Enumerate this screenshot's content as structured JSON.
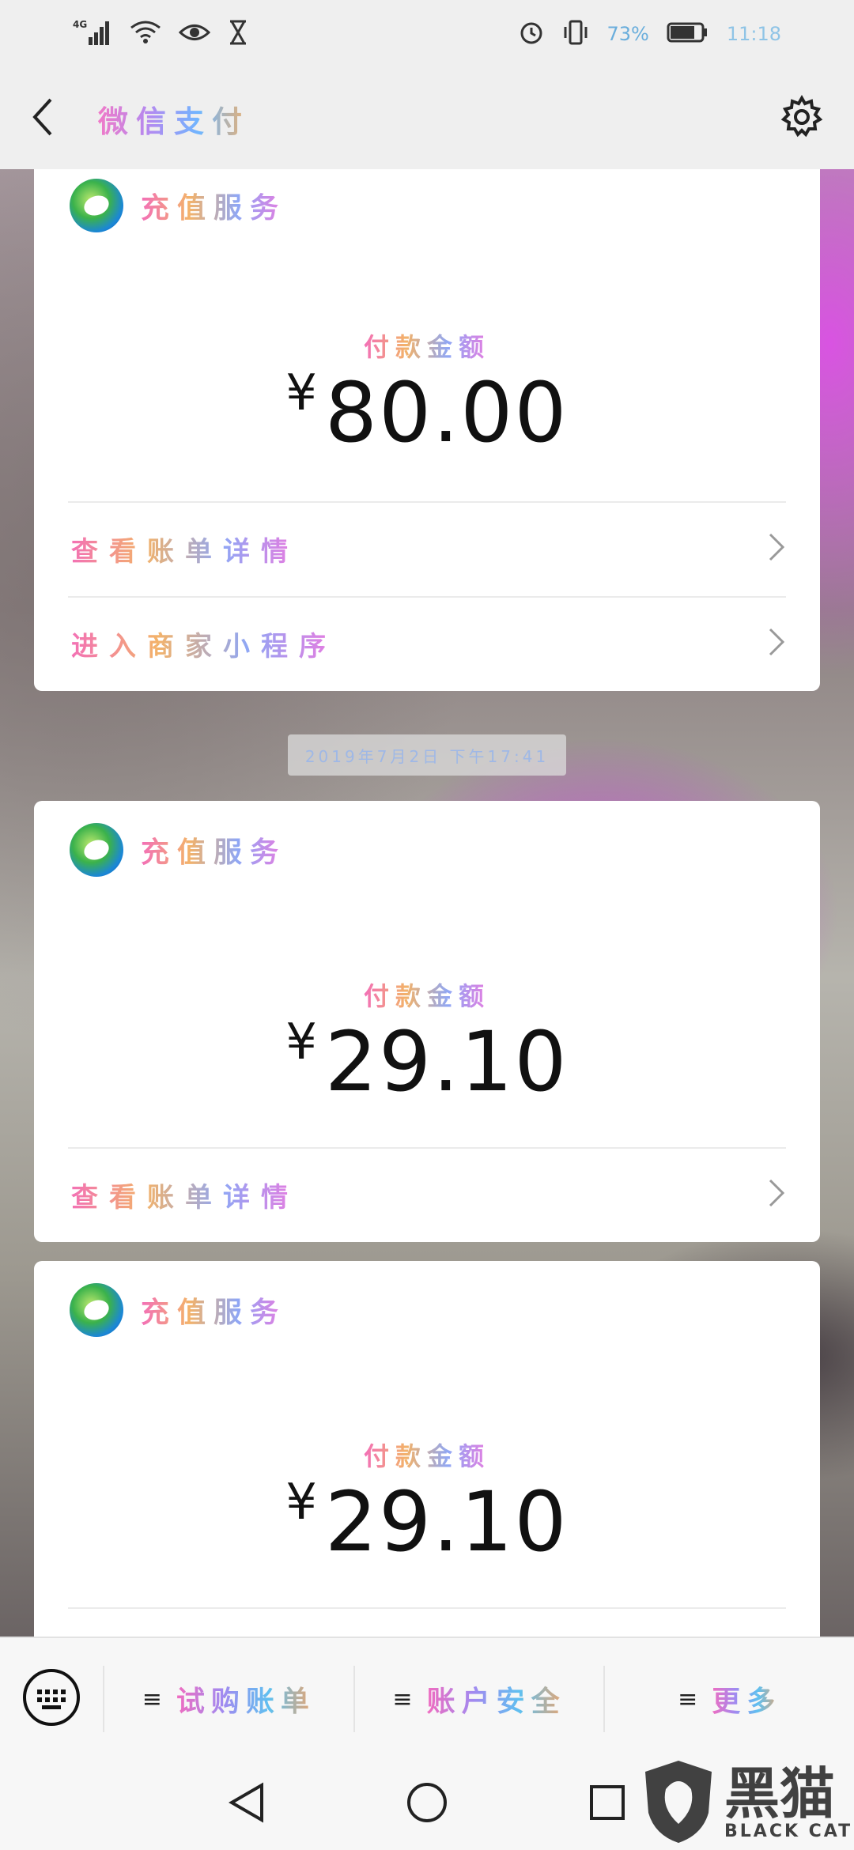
{
  "status_bar": {
    "network": "4G",
    "battery": "73%",
    "time": "11:18",
    "icons": [
      "signal-icon",
      "wifi-icon",
      "eye-icon",
      "hourglass-icon",
      "alarm-icon",
      "vibrate-icon",
      "battery-icon"
    ]
  },
  "navbar": {
    "title": "微信支付",
    "back_icon": "chevron-left-icon",
    "settings_icon": "gear-icon"
  },
  "cards": [
    {
      "merchant": "充值服务",
      "amount_label": "付款金额",
      "currency": "¥",
      "amount": "80.00",
      "rows": [
        "查看账单详情",
        "进入商家小程序"
      ]
    },
    {
      "merchant": "充值服务",
      "amount_label": "付款金额",
      "currency": "¥",
      "amount": "29.10",
      "rows": [
        "查看账单详情"
      ]
    },
    {
      "merchant": "充值服务",
      "amount_label": "付款金额",
      "currency": "¥",
      "amount": "29.10",
      "rows": []
    }
  ],
  "timestamp": "2019年7月2日 下午17:41",
  "bottom_menu": {
    "keyboard_icon": "keyboard-icon",
    "items": [
      "试购账单",
      "账户安全",
      "更多"
    ]
  },
  "system_nav": [
    "back-triangle-icon",
    "home-circle-icon",
    "recents-square-icon"
  ],
  "watermark": {
    "cn": "黑猫",
    "en": "BLACK CAT"
  },
  "colors": {
    "page_bg": "#efefef",
    "card_bg": "#ffffff",
    "amount_text": "#111111"
  }
}
